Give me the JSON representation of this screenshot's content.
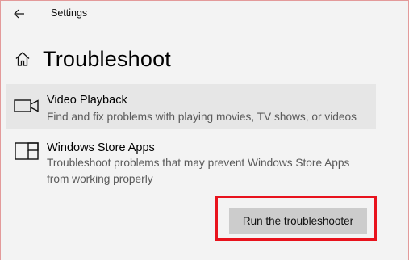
{
  "titlebar": {
    "back_icon": "arrow-left-icon",
    "app_title": "Settings"
  },
  "header": {
    "home_icon": "home-icon",
    "title": "Troubleshoot"
  },
  "items": [
    {
      "icon": "video-camera-icon",
      "title": "Video Playback",
      "description": "Find and fix problems with playing movies, TV shows, or videos",
      "selected": true
    },
    {
      "icon": "app-window-icon",
      "title": "Windows Store Apps",
      "description": "Troubleshoot problems that may prevent Windows Store Apps from working properly",
      "selected": false,
      "action_button": "Run the troubleshooter"
    }
  ],
  "colors": {
    "background": "#f3f3f3",
    "selected_item": "#e6e6e6",
    "button": "#cccccc",
    "highlight": "#e8121c"
  }
}
